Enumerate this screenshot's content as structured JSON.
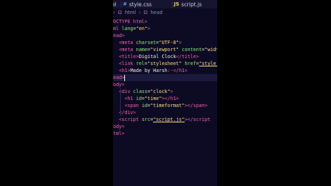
{
  "tabs": [
    {
      "icon": "",
      "label": "el"
    },
    {
      "icon": "#",
      "label": "style.css"
    },
    {
      "icon": "JS",
      "label": "script.js"
    }
  ],
  "breadcrumb": {
    "parent": "html",
    "current": "head"
  },
  "code_lines": [
    [
      {
        "t": "OCTYPE html",
        "c": "tag"
      },
      {
        "t": ">",
        "c": "tag"
      }
    ],
    [
      {
        "t": "ml ",
        "c": "tag"
      },
      {
        "t": "lang",
        "c": "attr"
      },
      {
        "t": "=",
        "c": "txt"
      },
      {
        "t": "\"en\"",
        "c": "str"
      },
      {
        "t": ">",
        "c": "tag"
      }
    ],
    [
      {
        "t": "ead",
        "c": "tag"
      },
      {
        "t": ">",
        "c": "tag"
      }
    ],
    [
      {
        "t": "  ",
        "c": "txt"
      },
      {
        "t": "<meta ",
        "c": "tag"
      },
      {
        "t": "charset",
        "c": "attr"
      },
      {
        "t": "=",
        "c": "txt"
      },
      {
        "t": "\"UTF-8\"",
        "c": "str"
      },
      {
        "t": ">",
        "c": "tag"
      }
    ],
    [
      {
        "t": "  ",
        "c": "txt"
      },
      {
        "t": "<meta ",
        "c": "tag"
      },
      {
        "t": "name",
        "c": "attr"
      },
      {
        "t": "=",
        "c": "txt"
      },
      {
        "t": "\"viewport\"",
        "c": "str"
      },
      {
        "t": " content",
        "c": "attr"
      },
      {
        "t": "=",
        "c": "txt"
      },
      {
        "t": "\"width",
        "c": "str"
      }
    ],
    [
      {
        "t": "  ",
        "c": "txt"
      },
      {
        "t": "<title>",
        "c": "tag"
      },
      {
        "t": "Digital Clock",
        "c": "txt"
      },
      {
        "t": "</title>",
        "c": "tag"
      }
    ],
    [
      {
        "t": "  ",
        "c": "txt"
      },
      {
        "t": "<link ",
        "c": "tag"
      },
      {
        "t": "rel",
        "c": "attr"
      },
      {
        "t": "=",
        "c": "txt"
      },
      {
        "t": "\"stylesheet\"",
        "c": "str"
      },
      {
        "t": " href",
        "c": "attr"
      },
      {
        "t": "=",
        "c": "txt"
      },
      {
        "t": "\"style.c",
        "c": "str link"
      }
    ],
    [
      {
        "t": "  ",
        "c": "txt"
      },
      {
        "t": "<h1>",
        "c": "tag"
      },
      {
        "t": "Made by Harsh",
        "c": "txt"
      },
      {
        "t": ":-",
        "c": "ent"
      },
      {
        "t": "</h1>",
        "c": "tag"
      }
    ],
    [
      {
        "t": "ead>",
        "c": "tag"
      },
      {
        "t": "",
        "c": "cursor"
      }
    ],
    [
      {
        "t": "ody>",
        "c": "tag"
      }
    ],
    [
      {
        "t": "  ",
        "c": "txt"
      },
      {
        "t": "<div ",
        "c": "tag"
      },
      {
        "t": "class",
        "c": "attr"
      },
      {
        "t": "=",
        "c": "txt"
      },
      {
        "t": "\"clock\"",
        "c": "str"
      },
      {
        "t": ">",
        "c": "tag"
      }
    ],
    [
      {
        "t": "    ",
        "c": "txt"
      },
      {
        "t": "<h1 ",
        "c": "tag"
      },
      {
        "t": "id",
        "c": "attr"
      },
      {
        "t": "=",
        "c": "txt"
      },
      {
        "t": "\"time\"",
        "c": "str"
      },
      {
        "t": "></h1>",
        "c": "tag"
      }
    ],
    [
      {
        "t": "    ",
        "c": "txt"
      },
      {
        "t": "<span ",
        "c": "tag"
      },
      {
        "t": "id",
        "c": "attr"
      },
      {
        "t": "=",
        "c": "txt"
      },
      {
        "t": "\"timeformat\"",
        "c": "str"
      },
      {
        "t": "></span>",
        "c": "tag"
      }
    ],
    [
      {
        "t": "  ",
        "c": "txt"
      },
      {
        "t": "</div>",
        "c": "tag"
      }
    ],
    [
      {
        "t": "  ",
        "c": "txt"
      },
      {
        "t": "<script ",
        "c": "tag"
      },
      {
        "t": "src",
        "c": "attr"
      },
      {
        "t": "=",
        "c": "txt"
      },
      {
        "t": "\"script.js\"",
        "c": "str link"
      },
      {
        "t": "></script",
        "c": "tag"
      }
    ],
    [
      {
        "t": "ody>",
        "c": "tag"
      }
    ],
    [
      {
        "t": "tml>",
        "c": "tag"
      }
    ]
  ],
  "current_line": 8
}
